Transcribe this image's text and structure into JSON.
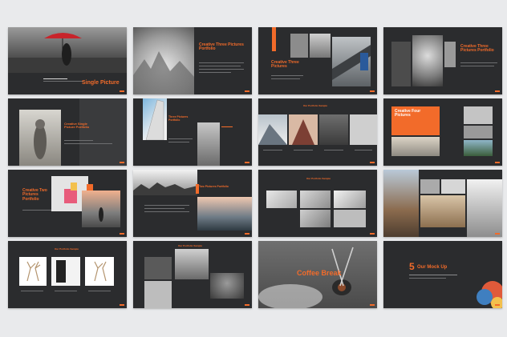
{
  "colors": {
    "background": "#e9eaec",
    "slide": "#2b2c2e",
    "accent": "#f26b2a"
  },
  "slides": [
    {
      "title": "Single Picture"
    },
    {
      "title": "Creative Three Pictures Portfolio"
    },
    {
      "title": "Creative Three Pictures"
    },
    {
      "title": "Creative Three Pictures Portfolio"
    },
    {
      "title": "Creative Single Picture Portfolio"
    },
    {
      "title": "Three Pictures Portfolio"
    },
    {
      "title": "Our Portfolio Sample"
    },
    {
      "title": "Creative Four Pictures"
    },
    {
      "title": "Creative Two Pictures Portfolio"
    },
    {
      "title": "Two Pictures Portfolio"
    },
    {
      "title": "Our Portfolio Sample"
    },
    {
      "title": ""
    },
    {
      "title": "Our Portfolio Sample"
    },
    {
      "title": "Our Portfolio Sample"
    },
    {
      "title": "Coffee Break"
    },
    {
      "number": "5",
      "title": "Our Mock Up"
    }
  ]
}
